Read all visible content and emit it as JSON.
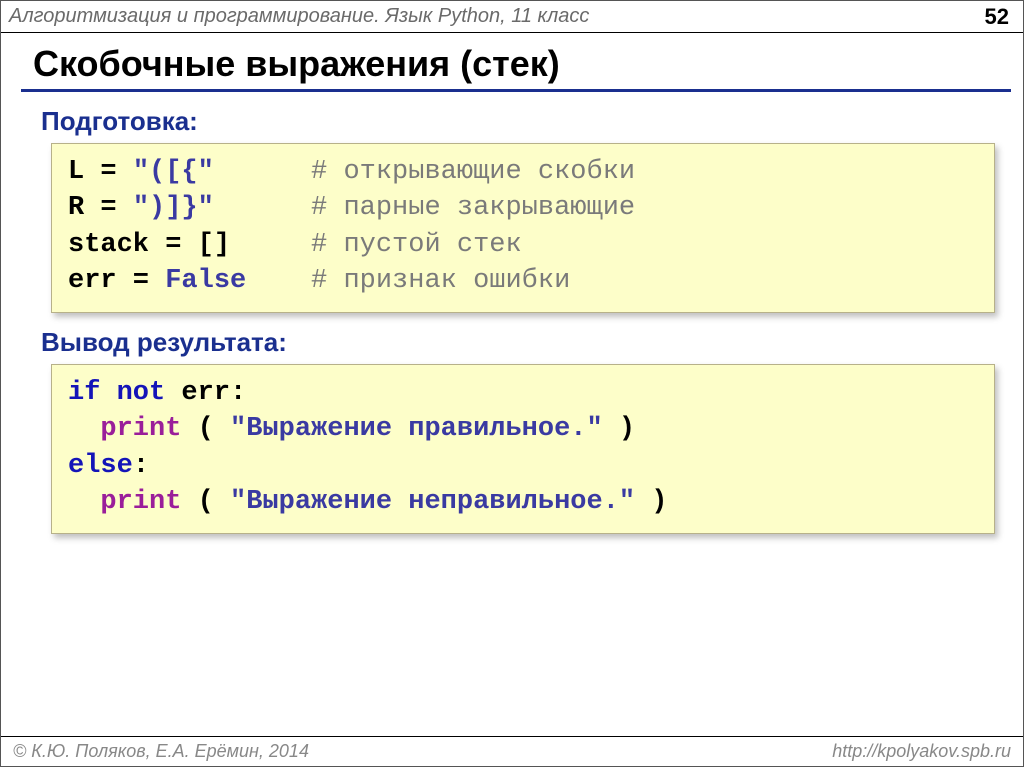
{
  "header": {
    "course_title": "Алгоритмизация и программирование. Язык Python, 11 класс",
    "page_number": "52"
  },
  "title": "Скобочные выражения (стек)",
  "section1_label": "Подготовка:",
  "section2_label": "Вывод результата:",
  "code1": {
    "rows": [
      [
        {
          "cls": "seg-black",
          "t": "L"
        },
        {
          "cls": "seg-black",
          "t": " = "
        },
        {
          "cls": "seg-string",
          "t": "\"([{\""
        },
        {
          "cls": "seg-black",
          "t": "      "
        },
        {
          "cls": "seg-comment",
          "t": "# открывающие скобки"
        }
      ],
      [
        {
          "cls": "seg-black",
          "t": "R"
        },
        {
          "cls": "seg-black",
          "t": " = "
        },
        {
          "cls": "seg-string",
          "t": "\")]}\""
        },
        {
          "cls": "seg-black",
          "t": "      "
        },
        {
          "cls": "seg-comment",
          "t": "# парные закрывающие"
        }
      ],
      [
        {
          "cls": "seg-black",
          "t": "stack"
        },
        {
          "cls": "seg-black",
          "t": " = "
        },
        {
          "cls": "seg-black",
          "t": "[]"
        },
        {
          "cls": "seg-black",
          "t": "     "
        },
        {
          "cls": "seg-comment",
          "t": "# пустой стек"
        }
      ],
      [
        {
          "cls": "seg-black",
          "t": "err"
        },
        {
          "cls": "seg-black",
          "t": " = "
        },
        {
          "cls": "seg-value",
          "t": "False"
        },
        {
          "cls": "seg-black",
          "t": "    "
        },
        {
          "cls": "seg-comment",
          "t": "# признак ошибки"
        }
      ]
    ]
  },
  "code2": {
    "rows": [
      [
        {
          "cls": "seg-keyword",
          "t": "if not "
        },
        {
          "cls": "seg-black",
          "t": "err:"
        }
      ],
      [
        {
          "cls": "seg-black",
          "t": "  "
        },
        {
          "cls": "seg-func",
          "t": "print"
        },
        {
          "cls": "seg-black",
          "t": " ( "
        },
        {
          "cls": "seg-string",
          "t": "\"Выражение правильное.\""
        },
        {
          "cls": "seg-black",
          "t": " )"
        }
      ],
      [
        {
          "cls": "seg-keyword",
          "t": "else"
        },
        {
          "cls": "seg-black",
          "t": ":"
        }
      ],
      [
        {
          "cls": "seg-black",
          "t": "  "
        },
        {
          "cls": "seg-func",
          "t": "print"
        },
        {
          "cls": "seg-black",
          "t": " ( "
        },
        {
          "cls": "seg-string",
          "t": "\"Выражение неправильное.\""
        },
        {
          "cls": "seg-black",
          "t": " )"
        }
      ]
    ]
  },
  "footer": {
    "copyright": "© К.Ю. Поляков, Е.А. Ерёмин, 2014",
    "url": "http://kpolyakov.spb.ru"
  }
}
